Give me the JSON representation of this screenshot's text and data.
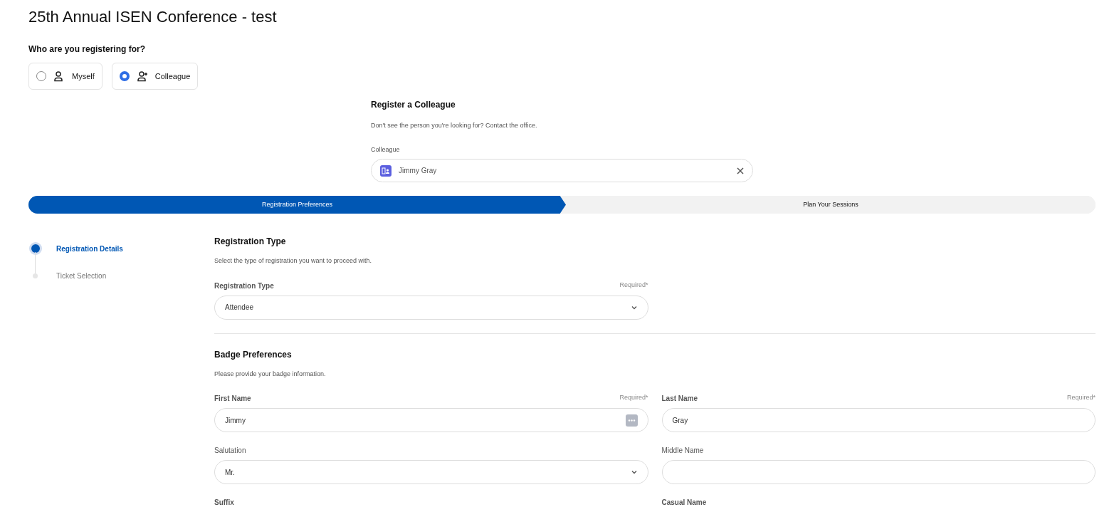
{
  "title": "25th Annual ISEN Conference - test",
  "registrant": {
    "question": "Who are you registering for?",
    "options": [
      {
        "label": "Myself",
        "kind": "person",
        "selected": false
      },
      {
        "label": "Colleague",
        "kind": "person-add",
        "selected": true
      }
    ]
  },
  "colleague_section": {
    "heading": "Register a Colleague",
    "hint": "Don't see the person you're looking for? Contact the office.",
    "field_label": "Colleague",
    "value": "Jimmy Gray"
  },
  "progress": [
    {
      "label": "Registration Preferences",
      "selected": true
    },
    {
      "label": "Plan Your Sessions",
      "selected": false
    }
  ],
  "steps": [
    {
      "label": "Registration Details",
      "selected": true
    },
    {
      "label": "Ticket Selection",
      "selected": false
    }
  ],
  "sections": [
    {
      "heading": "Registration Type",
      "description": "Select the type of registration you want to proceed with.",
      "fields": [
        {
          "label": "Registration Type",
          "required": "Required*",
          "kind": "select",
          "value": "Attendee"
        }
      ]
    },
    {
      "heading": "Badge Preferences",
      "description": "Please provide your badge information.",
      "fields": [
        {
          "label": "First Name",
          "required": "Required*",
          "kind": "text",
          "value": "Jimmy",
          "autofill": true
        },
        {
          "label": "Last Name",
          "required": "Required*",
          "kind": "text",
          "value": "Gray"
        },
        {
          "label": "Salutation",
          "kind": "select",
          "value": "Mr."
        },
        {
          "label": "Middle Name",
          "kind": "text"
        },
        {
          "label": "Suffix",
          "kind": "label-only"
        },
        {
          "label": "Casual Name",
          "kind": "label-only"
        }
      ]
    }
  ]
}
